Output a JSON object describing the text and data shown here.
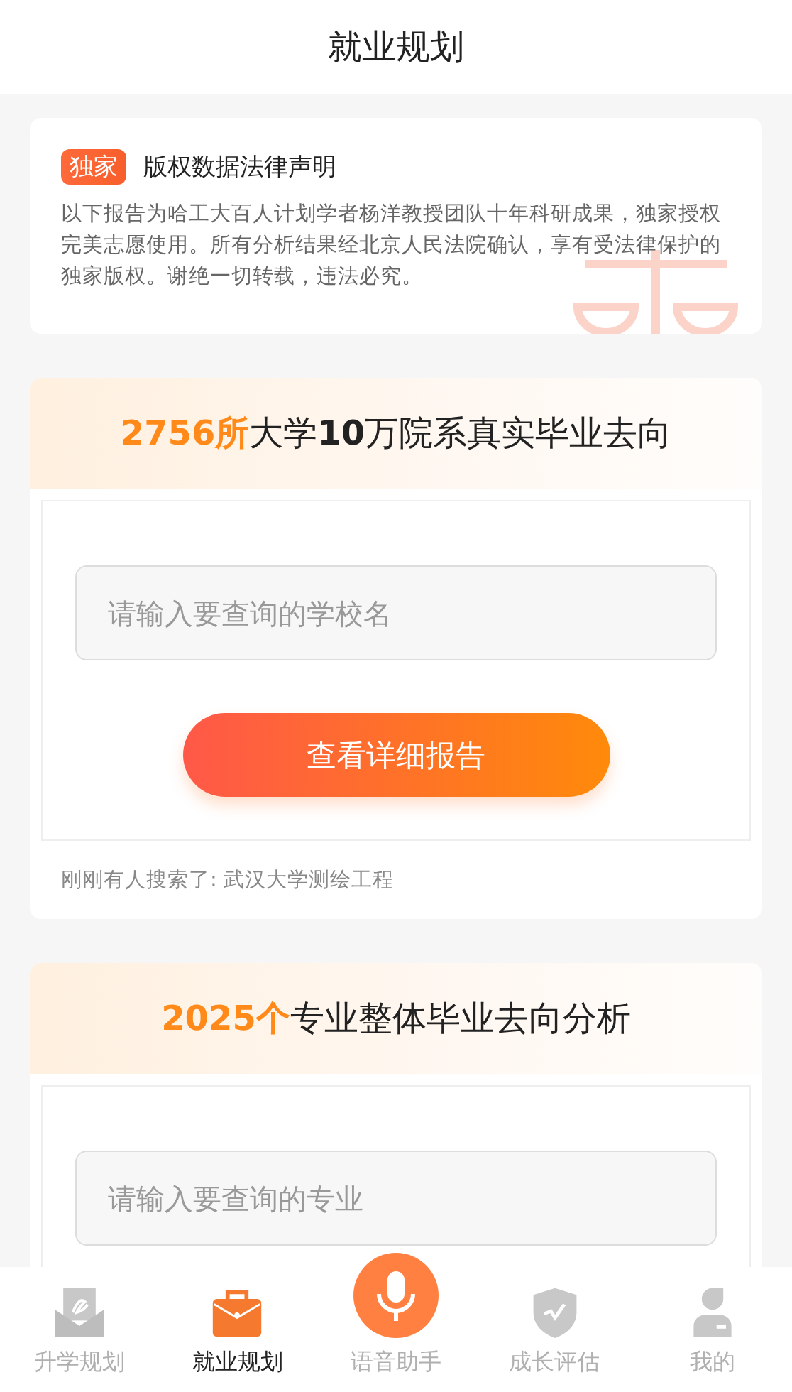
{
  "header": {
    "title": "就业规划"
  },
  "notice": {
    "badge": "独家",
    "title": "版权数据法律声明",
    "body": "以下报告为哈工大百人计划学者杨洋教授团队十年科研成果，独家授权完美志愿使用。所有分析结果经北京人民法院确认，享有受法律保护的独家版权。谢绝一切转载，违法必究。"
  },
  "cards": [
    {
      "title_parts": [
        {
          "text": "2756所",
          "kind": "highlight"
        },
        {
          "text": "大学",
          "kind": "plain"
        },
        {
          "text": "10",
          "kind": "bold"
        },
        {
          "text": "万院系真实毕业去向",
          "kind": "plain"
        }
      ],
      "search": {
        "placeholder": "请输入要查询的学校名"
      },
      "button": "查看详细报告",
      "recent": "刚刚有人搜索了: 武汉大学测绘工程"
    },
    {
      "title_parts": [
        {
          "text": "2025个",
          "kind": "highlight"
        },
        {
          "text": "专业整体毕业去向分析",
          "kind": "plain"
        }
      ],
      "search": {
        "placeholder": "请输入要查询的专业"
      }
    }
  ],
  "tab_bar": [
    {
      "label": "升学规划",
      "kind": "admission",
      "selected": false
    },
    {
      "label": "就业规划",
      "kind": "job",
      "selected": true
    },
    {
      "label": "语音助手",
      "kind": "voice",
      "selected": false
    },
    {
      "label": "成长评估",
      "kind": "growth",
      "selected": false
    },
    {
      "label": "我的",
      "kind": "profile",
      "selected": false
    }
  ]
}
